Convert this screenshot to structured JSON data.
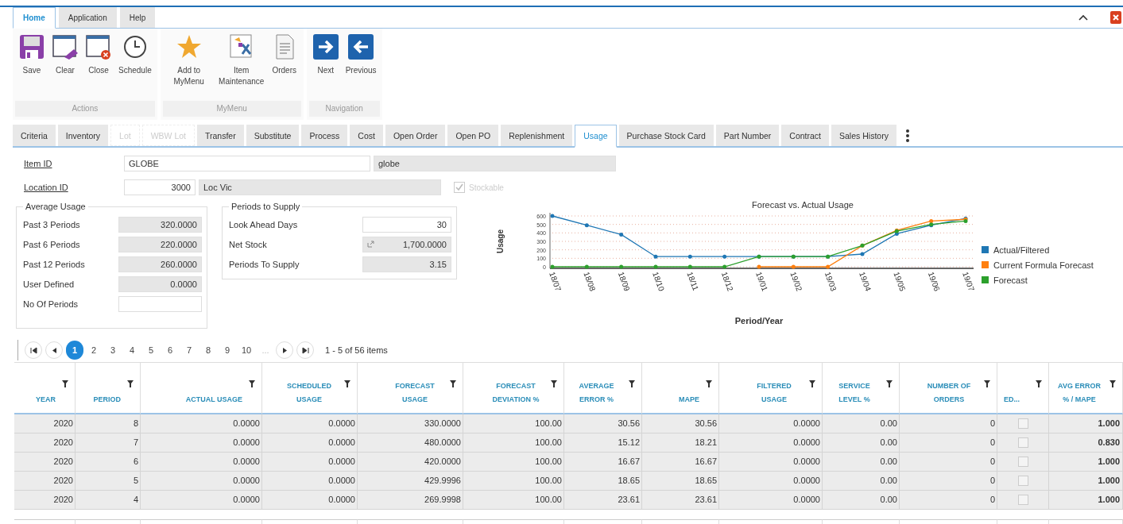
{
  "ribbon": {
    "tabs": [
      {
        "label": "Home",
        "selected": true
      },
      {
        "label": "Application",
        "selected": false
      },
      {
        "label": "Help",
        "selected": false
      }
    ],
    "groups": [
      {
        "label": "Actions",
        "buttons": [
          {
            "label": "Save"
          },
          {
            "label": "Clear"
          },
          {
            "label": "Close"
          },
          {
            "label": "Schedule"
          }
        ]
      },
      {
        "label": "MyMenu",
        "buttons": [
          {
            "label": "Add to MyMenu"
          },
          {
            "label": "Item Maintenance"
          },
          {
            "label": "Orders"
          }
        ]
      },
      {
        "label": "Navigation",
        "buttons": [
          {
            "label": "Next"
          },
          {
            "label": "Previous"
          }
        ]
      }
    ]
  },
  "tabs": [
    {
      "label": "Criteria",
      "selected": false,
      "disabled": false
    },
    {
      "label": "Inventory",
      "selected": false,
      "disabled": false
    },
    {
      "label": "Lot",
      "selected": false,
      "disabled": true
    },
    {
      "label": "WBW Lot",
      "selected": false,
      "disabled": true
    },
    {
      "label": "Transfer",
      "selected": false,
      "disabled": false
    },
    {
      "label": "Substitute",
      "selected": false,
      "disabled": false
    },
    {
      "label": "Process",
      "selected": false,
      "disabled": false
    },
    {
      "label": "Cost",
      "selected": false,
      "disabled": false
    },
    {
      "label": "Open Order",
      "selected": false,
      "disabled": false
    },
    {
      "label": "Open PO",
      "selected": false,
      "disabled": false
    },
    {
      "label": "Replenishment",
      "selected": false,
      "disabled": false
    },
    {
      "label": "Usage",
      "selected": true,
      "disabled": false
    },
    {
      "label": "Purchase Stock Card",
      "selected": false,
      "disabled": false
    },
    {
      "label": "Part Number",
      "selected": false,
      "disabled": false
    },
    {
      "label": "Contract",
      "selected": false,
      "disabled": false
    },
    {
      "label": "Sales History",
      "selected": false,
      "disabled": false
    }
  ],
  "item_id": {
    "label": "Item ID",
    "code": "GLOBE",
    "description": "globe"
  },
  "location_id": {
    "label": "Location ID",
    "code": "3000",
    "description": "Loc Vic"
  },
  "stockable": {
    "label": "Stockable",
    "checked": true,
    "disabled": true
  },
  "average_usage": {
    "title": "Average Usage",
    "rows": [
      {
        "label": "Past 3 Periods",
        "value": "320.0000",
        "editable": false
      },
      {
        "label": "Past 6 Periods",
        "value": "220.0000",
        "editable": false
      },
      {
        "label": "Past 12 Periods",
        "value": "260.0000",
        "editable": false
      },
      {
        "label": "User Defined",
        "value": "0.0000",
        "editable": false
      },
      {
        "label": "No Of Periods",
        "editable": true
      }
    ]
  },
  "periods_to_supply": {
    "title": "Periods to Supply",
    "rows": [
      {
        "label": "Look Ahead Days",
        "value": "30",
        "editable": true
      },
      {
        "label": "Net Stock",
        "value": "1,700.0000",
        "editable": false,
        "link": true
      },
      {
        "label": "Periods To Supply",
        "value": "3.15",
        "editable": false
      }
    ]
  },
  "chart": {
    "chart_data": {
      "type": "line",
      "title": "Forecast vs. Actual Usage",
      "xlabel": "Period/Year",
      "ylabel": "Usage",
      "categories": [
        "18/07",
        "18/08",
        "18/09",
        "18/10",
        "18/11",
        "18/12",
        "19/01",
        "19/02",
        "19/03",
        "19/04",
        "19/05",
        "19/06",
        "19/07"
      ],
      "ylim": [
        0,
        600
      ],
      "grid": true,
      "legend": true,
      "yticks": [
        0,
        100,
        200,
        300,
        400,
        500,
        600
      ],
      "series": [
        {
          "name": "Actual/Filtered",
          "color": "#1f77b4",
          "values": [
            600,
            490,
            380,
            120,
            120,
            120,
            120,
            120,
            120,
            150,
            390,
            490,
            570
          ]
        },
        {
          "name": "Current Formula Forecast",
          "color": "#ff7f0e",
          "values": [
            null,
            null,
            null,
            null,
            null,
            null,
            0,
            0,
            0,
            250,
            430,
            540,
            560
          ]
        },
        {
          "name": "Forecast",
          "color": "#2ca02c",
          "values": [
            0,
            0,
            0,
            0,
            0,
            0,
            120,
            120,
            120,
            250,
            420,
            500,
            540
          ]
        }
      ]
    }
  },
  "pager": {
    "pages": [
      {
        "label": "1",
        "selected": true
      },
      {
        "label": "2",
        "selected": false
      },
      {
        "label": "3",
        "selected": false
      },
      {
        "label": "4",
        "selected": false
      },
      {
        "label": "5",
        "selected": false
      },
      {
        "label": "6",
        "selected": false
      },
      {
        "label": "7",
        "selected": false
      },
      {
        "label": "8",
        "selected": false
      },
      {
        "label": "9",
        "selected": false
      },
      {
        "label": "10",
        "selected": false
      }
    ],
    "more": "...",
    "info": "1 - 5 of 56 items"
  },
  "table": {
    "columns": [
      "YEAR",
      "PERIOD",
      "ACTUAL USAGE",
      "SCHEDULED USAGE",
      "FORECAST USAGE",
      "FORECAST DEVIATION %",
      "AVERAGE ERROR %",
      "MAPE",
      "FILTERED USAGE",
      "SERVICE LEVEL %",
      "NUMBER OF ORDERS",
      "ED...",
      "AVG ERROR % / MAPE"
    ],
    "rows": [
      {
        "cells": [
          "2020",
          "8",
          "0.0000",
          "0.0000",
          "330.0000",
          "100.00",
          "30.56",
          "30.56",
          "0.0000",
          "0.00",
          "0"
        ],
        "ed_checked": false,
        "ratio": "1.000"
      },
      {
        "cells": [
          "2020",
          "7",
          "0.0000",
          "0.0000",
          "480.0000",
          "100.00",
          "15.12",
          "18.21",
          "0.0000",
          "0.00",
          "0"
        ],
        "ed_checked": false,
        "ratio": "0.830"
      },
      {
        "cells": [
          "2020",
          "6",
          "0.0000",
          "0.0000",
          "420.0000",
          "100.00",
          "16.67",
          "16.67",
          "0.0000",
          "0.00",
          "0"
        ],
        "ed_checked": false,
        "ratio": "1.000"
      },
      {
        "cells": [
          "2020",
          "5",
          "0.0000",
          "0.0000",
          "429.9996",
          "100.00",
          "18.65",
          "18.65",
          "0.0000",
          "0.00",
          "0"
        ],
        "ed_checked": false,
        "ratio": "1.000"
      },
      {
        "cells": [
          "2020",
          "4",
          "0.0000",
          "0.0000",
          "269.9998",
          "100.00",
          "23.61",
          "23.61",
          "0.0000",
          "0.00",
          "0"
        ],
        "ed_checked": false,
        "ratio": "1.000"
      }
    ]
  }
}
